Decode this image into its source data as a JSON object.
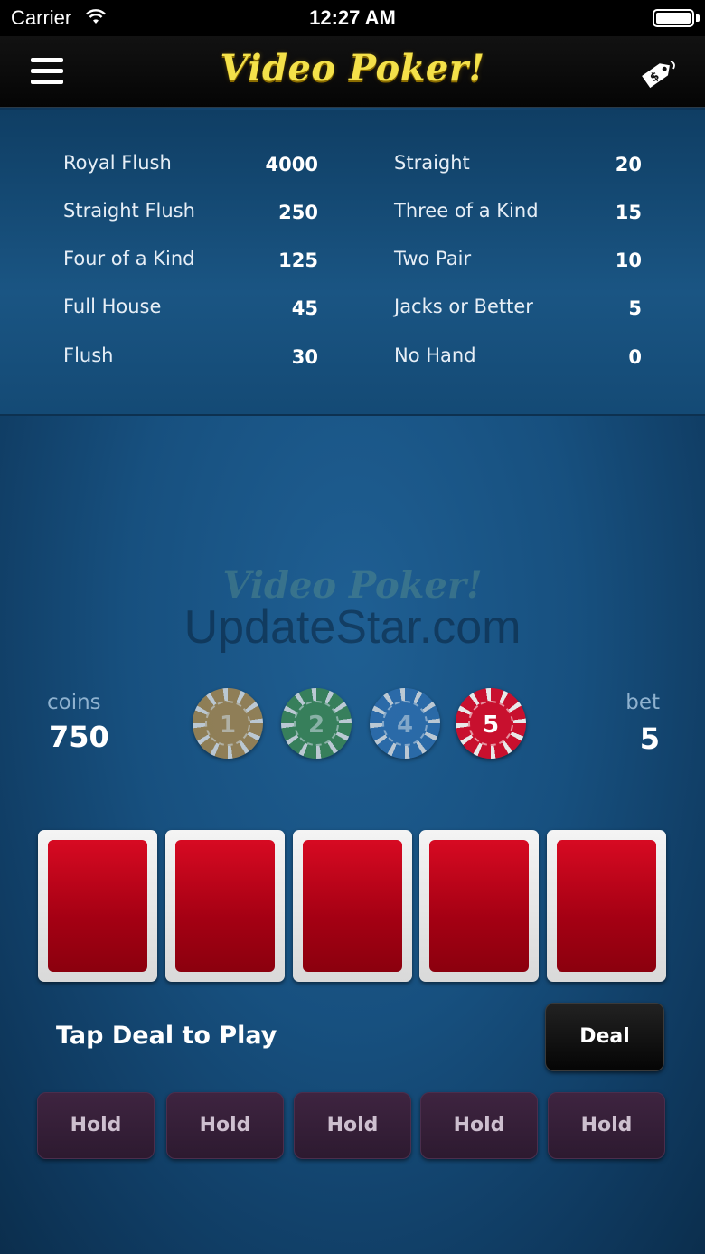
{
  "status_bar": {
    "carrier": "Carrier",
    "time": "12:27 AM"
  },
  "nav": {
    "title": "Video Poker!",
    "menu_icon": "hamburger-menu-icon",
    "store_icon": "price-tag-icon"
  },
  "paytable": {
    "left": [
      {
        "name": "Royal Flush",
        "value": "4000"
      },
      {
        "name": "Straight Flush",
        "value": "250"
      },
      {
        "name": "Four of a Kind",
        "value": "125"
      },
      {
        "name": "Full House",
        "value": "45"
      },
      {
        "name": "Flush",
        "value": "30"
      }
    ],
    "right": [
      {
        "name": "Straight",
        "value": "20"
      },
      {
        "name": "Three of a Kind",
        "value": "15"
      },
      {
        "name": "Two Pair",
        "value": "10"
      },
      {
        "name": "Jacks or Better",
        "value": "5"
      },
      {
        "name": "No Hand",
        "value": "0"
      }
    ]
  },
  "watermark": {
    "logo": "Video Poker!",
    "site": "UpdateStar.com"
  },
  "coins": {
    "label": "coins",
    "value": "750"
  },
  "bet": {
    "label": "bet",
    "value": "5"
  },
  "chips": [
    {
      "label": "1",
      "color": "#b08a4a",
      "selected": false
    },
    {
      "label": "2",
      "color": "#3f8a4e",
      "selected": false
    },
    {
      "label": "4",
      "color": "#2f6fb0",
      "selected": false
    },
    {
      "label": "5",
      "color": "#c8102e",
      "selected": true
    }
  ],
  "cards": {
    "count": 5,
    "face": "back",
    "back_color": "#c00018"
  },
  "game": {
    "status_text": "Tap Deal to Play",
    "deal_label": "Deal"
  },
  "holds": [
    "Hold",
    "Hold",
    "Hold",
    "Hold",
    "Hold"
  ]
}
